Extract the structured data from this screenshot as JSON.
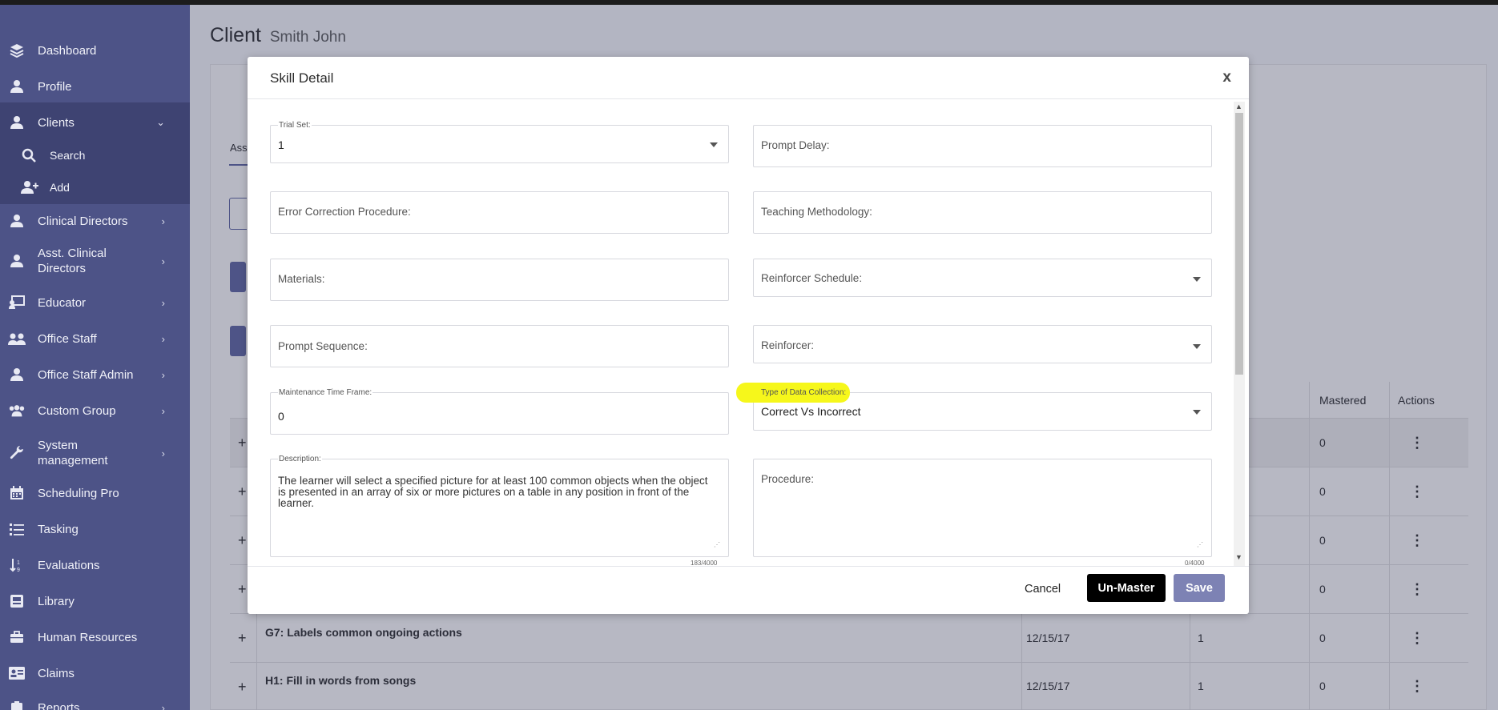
{
  "sidebar": {
    "items": [
      {
        "label": "Dashboard",
        "icon": "layers-icon",
        "chevron": ""
      },
      {
        "label": "Profile",
        "icon": "person-icon",
        "chevron": ""
      },
      {
        "label": "Clients",
        "icon": "person-icon",
        "chevron": "⌄"
      },
      {
        "label": "Search",
        "icon": "search-icon",
        "chevron": ""
      },
      {
        "label": "Add",
        "icon": "add-user-icon",
        "chevron": ""
      },
      {
        "label": "Clinical Directors",
        "icon": "person-tie-icon",
        "chevron": "›"
      },
      {
        "label": "Asst. Clinical Directors",
        "icon": "person-tie-icon",
        "chevron": "›"
      },
      {
        "label": "Educator",
        "icon": "chalkboard-icon",
        "chevron": "›"
      },
      {
        "label": "Office Staff",
        "icon": "group-icon",
        "chevron": "›"
      },
      {
        "label": "Office Staff Admin",
        "icon": "person-tie-icon",
        "chevron": "›"
      },
      {
        "label": "Custom Group",
        "icon": "users-icon",
        "chevron": "›"
      },
      {
        "label": "System management",
        "icon": "wrench-icon",
        "chevron": "›"
      },
      {
        "label": "Scheduling Pro",
        "icon": "calendar-icon",
        "chevron": ""
      },
      {
        "label": "Tasking",
        "icon": "list-icon",
        "chevron": ""
      },
      {
        "label": "Evaluations",
        "icon": "sort-icon",
        "chevron": ""
      },
      {
        "label": "Library",
        "icon": "book-icon",
        "chevron": ""
      },
      {
        "label": "Human Resources",
        "icon": "briefcase-icon",
        "chevron": ""
      },
      {
        "label": "Claims",
        "icon": "id-card-icon",
        "chevron": ""
      },
      {
        "label": "Reports",
        "icon": "clipboard-icon",
        "chevron": "›"
      }
    ]
  },
  "page": {
    "title": "Client",
    "client_name": "Smith John"
  },
  "background": {
    "tab_text": "Ass",
    "table_headers": {
      "mastered": "Mastered",
      "actions": "Actions"
    },
    "rows": [
      {
        "mastered": "0"
      },
      {
        "mastered": "0"
      },
      {
        "mastered": "0"
      },
      {
        "mastered": "0"
      },
      {
        "name": "G7: Labels common ongoing actions",
        "date": "12/15/17",
        "count": "1",
        "mastered": "0"
      },
      {
        "name": "H1: Fill in words from songs",
        "date": "12/15/17",
        "count": "1",
        "mastered": "0"
      }
    ]
  },
  "modal": {
    "title": "Skill Detail",
    "close": "x",
    "fields": {
      "trial_set": {
        "label": "Trial Set:",
        "value": "1"
      },
      "prompt_delay": {
        "placeholder": "Prompt Delay:"
      },
      "error_correction": {
        "placeholder": "Error Correction Procedure:"
      },
      "teaching_methodology": {
        "placeholder": "Teaching Methodology:"
      },
      "materials": {
        "placeholder": "Materials:"
      },
      "reinforcer_schedule": {
        "placeholder": "Reinforcer Schedule:"
      },
      "prompt_sequence": {
        "placeholder": "Prompt Sequence:"
      },
      "reinforcer": {
        "placeholder": "Reinforcer:"
      },
      "maintenance_time_frame": {
        "label": "Maintenance Time Frame:",
        "value": "0"
      },
      "type_of_data_collection": {
        "label": "Type of Data Collection:",
        "value": "Correct Vs Incorrect"
      },
      "description": {
        "label": "Description:",
        "value": "The learner will select a specified picture for at least 100 common objects when the object is presented in an array of six or more pictures on a table in any position in front of the learner."
      },
      "procedure": {
        "placeholder": "Procedure:"
      }
    },
    "counters": {
      "description": "183/4000",
      "procedure": "0/4000"
    },
    "buttons": {
      "cancel": "Cancel",
      "unmaster": "Un-Master",
      "save": "Save"
    }
  },
  "colors": {
    "sidebar": "#4d5387",
    "highlight": "#f6f71b",
    "save_button": "#7d82b4",
    "unmaster_button": "#000000"
  }
}
